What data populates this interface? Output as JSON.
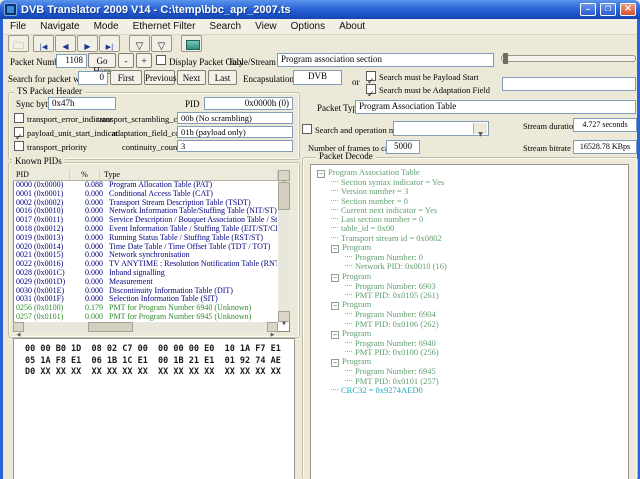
{
  "window": {
    "title": "DVB Translator 2009 V14 - C:\\temp\\bbc_apr_2007.ts"
  },
  "menu": {
    "items": [
      "File",
      "Navigate",
      "Mode",
      "Ethernet Filter",
      "Search",
      "View",
      "Options",
      "About"
    ]
  },
  "toolbar": {
    "icons": [
      "open-file",
      "go-first",
      "go-previous",
      "go-next",
      "go-last",
      "filter",
      "filter-alt",
      "ethernet-capture"
    ]
  },
  "packet_nav": {
    "packet_number_label": "Packet Number",
    "packet_number_value": "1108",
    "go_here_label": "Go Here",
    "decrement_label": "-",
    "increment_label": "+",
    "display_packet_only_label": "Display Packet Only",
    "table_stream_id_label": "Table/Stream id",
    "table_stream_id_value": "Program association section"
  },
  "pid_search": {
    "label": "Search for packet with PID",
    "value": "0",
    "first_label": "First",
    "previous_label": "Previous",
    "next_label": "Next",
    "last_label": "Last",
    "encapsulation_label": "Encapsulation",
    "encapsulation_value": "DVB",
    "or_label": "or",
    "payload_start_label": "Search must be Payload Start",
    "adaptation_field_label": "Search must be Adaptation Field"
  },
  "ts_packet_header": {
    "title": "TS Packet Header",
    "sync_byte_label": "Sync byte",
    "sync_byte_value": "0x47h",
    "pid_label": "PID",
    "pid_value": "0x0000h (0)",
    "transport_error_indicator_label": "transport_error_indicator",
    "transport_scrambling_control_label": "transport_scrambling_control",
    "transport_scrambling_control_value": "00b (No scrambling)",
    "payload_unit_start_label": "payload_unit_start_indicat",
    "adaptation_field_control_label": "adaptation_field_control",
    "adaptation_field_control_value": "01b (payload only)",
    "transport_priority_label": "transport_priority",
    "continuity_counter_label": "continuity_counter",
    "continuity_counter_value": "3"
  },
  "known_pids": {
    "title": "Known PIDs",
    "columns": [
      "PID",
      "%",
      "Type"
    ],
    "rows": [
      {
        "pid": "0000 (0x0000)",
        "pct": "0.088",
        "type": "Program Allocation Table (PAT)",
        "color": "navy"
      },
      {
        "pid": "0001 (0x0001)",
        "pct": "0.000",
        "type": "Conditional Access Table (CAT)",
        "color": "navy"
      },
      {
        "pid": "0002 (0x0002)",
        "pct": "0.000",
        "type": "Transport Stream Description Table (TSDT)",
        "color": "navy"
      },
      {
        "pid": "0016 (0x0010)",
        "pct": "0.000",
        "type": "Network Information Table/Stuffing Table (NIT/ST)",
        "color": "navy"
      },
      {
        "pid": "0017 (0x0011)",
        "pct": "0.000",
        "type": "Service Description / Bouquet Association Table / Stuffing Table (SDT/B",
        "color": "navy"
      },
      {
        "pid": "0018 (0x0012)",
        "pct": "0.000",
        "type": "Event Information Table / Stuffing Table (EIT/ST/CIT)",
        "color": "navy"
      },
      {
        "pid": "0019 (0x0013)",
        "pct": "0.000",
        "type": "Running Status Table / Stuffing Table (RST/ST)",
        "color": "navy"
      },
      {
        "pid": "0020 (0x0014)",
        "pct": "0.000",
        "type": "Time Date Table / Time Offset Table (TDT / TOT)",
        "color": "navy"
      },
      {
        "pid": "0021 (0x0015)",
        "pct": "0.000",
        "type": "Network synchronisation",
        "color": "navy"
      },
      {
        "pid": "0022 (0x0016)",
        "pct": "0.000",
        "type": "TV ANYTIME : Resolution Notification Table (RNT)",
        "color": "navy"
      },
      {
        "pid": "0028 (0x001C)",
        "pct": "0.000",
        "type": "Inband signalling",
        "color": "navy"
      },
      {
        "pid": "0029 (0x001D)",
        "pct": "0.000",
        "type": "Measurement",
        "color": "navy"
      },
      {
        "pid": "0030 (0x001E)",
        "pct": "0.000",
        "type": "Discontinuity Information Table (DIT)",
        "color": "navy"
      },
      {
        "pid": "0031 (0x001F)",
        "pct": "0.000",
        "type": "Selection Information Table (SIT)",
        "color": "navy"
      },
      {
        "pid": "0256 (0x0100)",
        "pct": "0.179",
        "type": "PMT for Program Number 6940 (Unknown)",
        "color": "green"
      },
      {
        "pid": "0257 (0x0101)",
        "pct": "0.000",
        "type": "PMT for Program Number 6945 (Unknown)",
        "color": "green"
      }
    ]
  },
  "hex_view": {
    "lines": [
      "00 00 B0 1D  08 02 C7 00  00 00 00 E0  10 1A F7 E1",
      "05 1A F8 E1  06 1B 1C E1  00 1B 21 E1  01 92 74 AE",
      "D0 XX XX XX  XX XX XX XX  XX XX XX XX  XX XX XX XX"
    ]
  },
  "packet_type": {
    "label": "Packet Type:",
    "value": "Program Association Table"
  },
  "search_mode": {
    "label": "Search and operation mode",
    "combo_value": ""
  },
  "capture": {
    "label": "Number of frames to capture",
    "value": "5000"
  },
  "stream_info": {
    "duration_label": "Stream duration",
    "duration_value": "4.727 seconds",
    "bitrate_label": "Stream bitrate",
    "bitrate_value": "16528.78 KBps"
  },
  "packet_decode": {
    "title": "Packet Decode",
    "tree": [
      {
        "label": "Program Association Table",
        "depth": 0,
        "expandable": true
      },
      {
        "label": "Section syntax indicator = Yes",
        "depth": 1
      },
      {
        "label": "Version number = 3",
        "depth": 1
      },
      {
        "label": "Section number = 0",
        "depth": 1
      },
      {
        "label": "Current next indicator = Yes",
        "depth": 1
      },
      {
        "label": "Last section number = 0",
        "depth": 1
      },
      {
        "label": "table_id = 0x00",
        "depth": 1
      },
      {
        "label": "Transport stream id = 0x0802",
        "depth": 1
      },
      {
        "label": "Program",
        "depth": 1,
        "expandable": true
      },
      {
        "label": "Program Number: 0",
        "depth": 2
      },
      {
        "label": "Network PID: 0x0010 (16)",
        "depth": 2
      },
      {
        "label": "Program",
        "depth": 1,
        "expandable": true
      },
      {
        "label": "Program Number: 6903",
        "depth": 2
      },
      {
        "label": "PMT PID: 0x0105 (261)",
        "depth": 2
      },
      {
        "label": "Program",
        "depth": 1,
        "expandable": true
      },
      {
        "label": "Program Number: 6904",
        "depth": 2
      },
      {
        "label": "PMT PID: 0x0106 (262)",
        "depth": 2
      },
      {
        "label": "Program",
        "depth": 1,
        "expandable": true
      },
      {
        "label": "Program Number: 6940",
        "depth": 2
      },
      {
        "label": "PMT PID: 0x0100 (256)",
        "depth": 2
      },
      {
        "label": "Program",
        "depth": 1,
        "expandable": true
      },
      {
        "label": "Program Number: 6945",
        "depth": 2
      },
      {
        "label": "PMT PID: 0x0101 (257)",
        "depth": 2
      },
      {
        "label": "CRC32 = 0x9274AED0",
        "depth": 1,
        "highlight": true
      }
    ]
  },
  "colors": {
    "titlebar_blue": "#2a63d5",
    "pid_row_text": "#000080",
    "pid_row_pmt_text": "#2e8b2e",
    "tree_text": "#5f9e6e",
    "crc_highlight_text": "#18a8b8",
    "window_background": "#ece9d8"
  }
}
